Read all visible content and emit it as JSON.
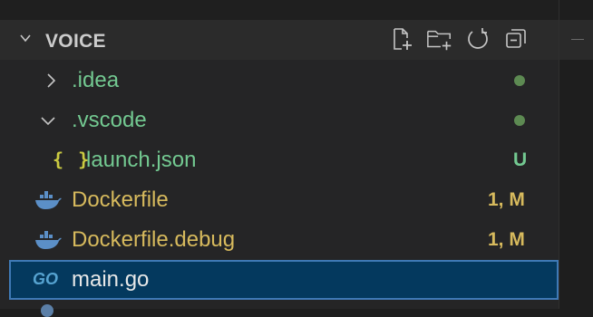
{
  "explorer": {
    "section_title": "VOICE",
    "actions": [
      {
        "name": "new-file",
        "icon": "new-file-icon"
      },
      {
        "name": "new-folder",
        "icon": "new-folder-icon"
      },
      {
        "name": "refresh",
        "icon": "refresh-icon"
      },
      {
        "name": "collapse-all",
        "icon": "collapse-all-icon"
      }
    ],
    "items": [
      {
        "label": ".idea",
        "kind": "folder",
        "expanded": false,
        "status": "dot",
        "label_color": "#73c991"
      },
      {
        "label": ".vscode",
        "kind": "folder",
        "expanded": true,
        "status": "dot",
        "label_color": "#73c991"
      },
      {
        "label": "launch.json",
        "kind": "json",
        "icon_text": "{ }",
        "badge": "U",
        "label_color": "#73c991"
      },
      {
        "label": "Dockerfile",
        "kind": "docker",
        "badge": "1, M",
        "label_color": "#d7ba5d"
      },
      {
        "label": "Dockerfile.debug",
        "kind": "docker",
        "badge": "1, M",
        "label_color": "#d7ba5d"
      },
      {
        "label": "main.go",
        "kind": "go",
        "icon_text": "GO",
        "selected": true,
        "label_color": "#e8e8e8"
      }
    ]
  },
  "colors": {
    "untracked_green": "#73c991",
    "modified_yellow": "#d7ba5d",
    "selection_bg": "#04395e",
    "selection_border": "#3f79b5",
    "panel_bg": "#252526"
  }
}
